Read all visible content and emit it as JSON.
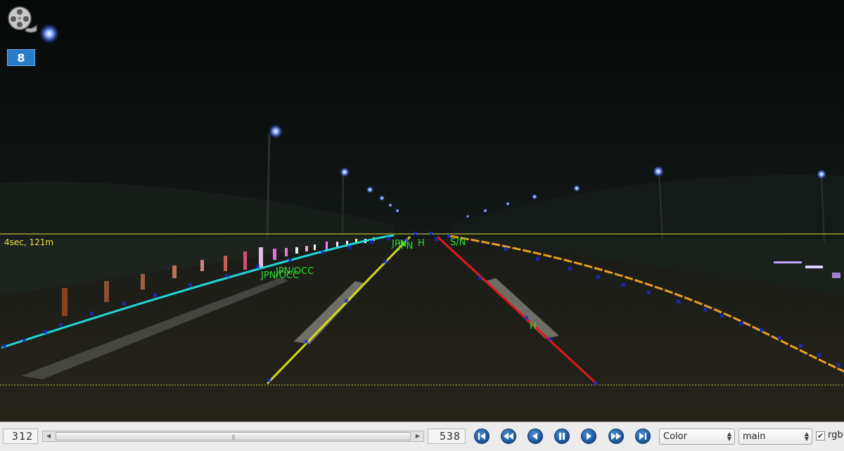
{
  "overlay": {
    "channel": "8",
    "horizon_label": "4sec, 121m",
    "lane_tags": {
      "left_far_a": "JPN",
      "left_far_b": "JPN",
      "left_far_c": "H",
      "right_far": "S/N",
      "left_mid_a": "JPN/OCC",
      "left_mid_b": "JPN/OCC",
      "right_mid": "H"
    }
  },
  "controls": {
    "current_frame": "312",
    "total_frames": "538",
    "scroll_position": 0.52,
    "buttons": [
      "first",
      "fast-backward",
      "step-backward",
      "pause",
      "play",
      "fast-forward",
      "last"
    ],
    "color_mode": "Color",
    "stream": "main",
    "rgb_label": "rgb",
    "rgb_checked": "✔"
  },
  "colors": {
    "ego_left_lane": "#d4d81e",
    "ego_right_lane": "#e01818",
    "left_boundary": "#20d8d8",
    "right_boundary": "#e8a020",
    "horizon_line": "#e8e040",
    "lane_tag": "#2ee02e",
    "point_marker": "#1a2ae0"
  }
}
